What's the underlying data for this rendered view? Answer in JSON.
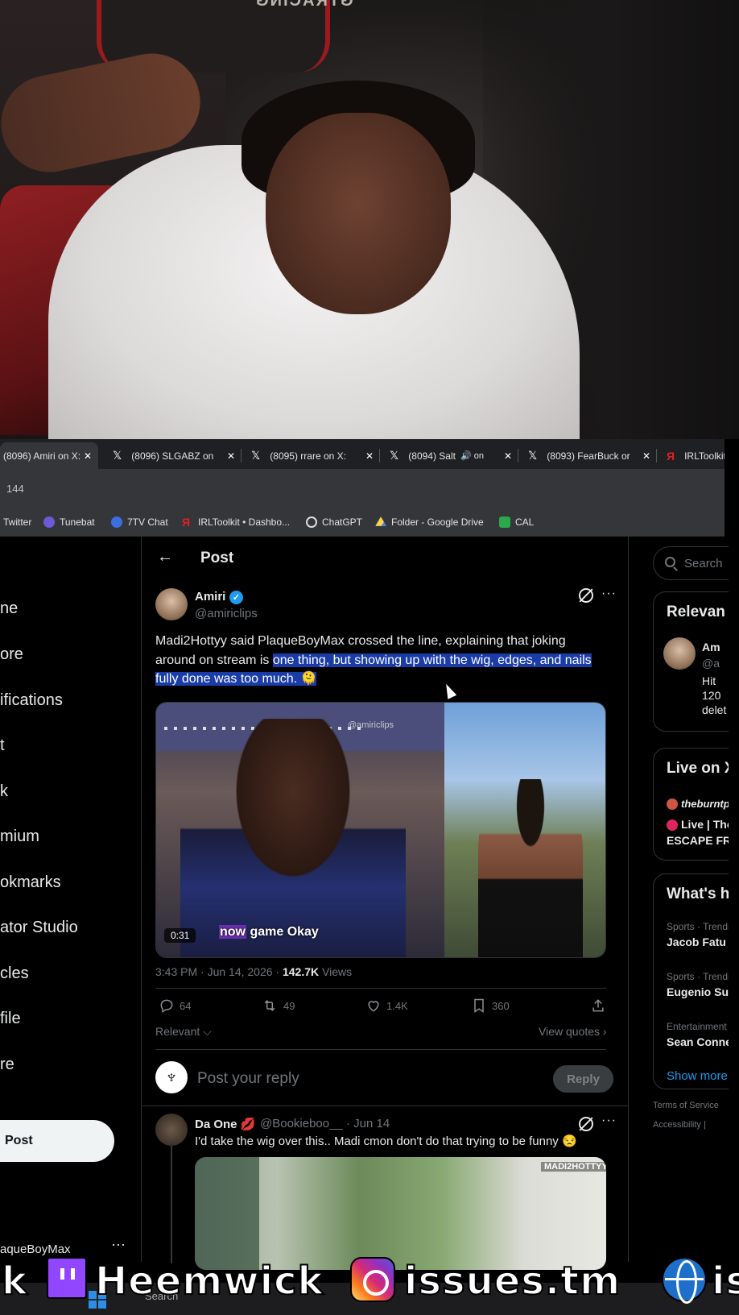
{
  "webcam": {
    "chair_brand": "GTRACING"
  },
  "tabs": [
    {
      "label": "(8096) Amiri on X:",
      "active": true
    },
    {
      "label": "(8096) SLGABZ on",
      "active": false
    },
    {
      "label": "(8095) rrare on X:",
      "active": false
    },
    {
      "label": "(8094) Salt",
      "active": false
    },
    {
      "label": "(8093) FearBuck or",
      "active": false
    },
    {
      "label": "IRLToolkit",
      "active": false
    }
  ],
  "address": {
    "url_fragment": "144"
  },
  "bookmarks": [
    {
      "label": "Twitter",
      "icon": "twitter-icon"
    },
    {
      "label": "Tunebat",
      "icon": "tunebat-icon"
    },
    {
      "label": "7TV Chat",
      "icon": "7tv-icon"
    },
    {
      "label": "IRLToolkit • Dashbo...",
      "icon": "irltoolkit-icon"
    },
    {
      "label": "ChatGPT",
      "icon": "chatgpt-icon"
    },
    {
      "label": "Folder - Google Drive",
      "icon": "drive-icon"
    },
    {
      "label": "CAL",
      "icon": "cal-icon"
    }
  ],
  "leftnav": {
    "items": [
      "ne",
      "ore",
      "ifications",
      "t",
      "k",
      "mium",
      "okmarks",
      "ator Studio",
      "cles",
      "file",
      "re"
    ],
    "post_button": "Post",
    "profile_handle": "aqueBoyMax",
    "more": "···"
  },
  "header": {
    "back": "←",
    "title": "Post"
  },
  "post": {
    "author_name": "Amiri",
    "verified": "✓",
    "author_handle": "@amiriclips",
    "text_plain": "Madi2Hottyy said PlaqueBoyMax crossed the line, explaining that joking around on stream is ",
    "text_highlighted": "one thing, but showing up with the wig, edges, and nails fully done was too much. 🫠",
    "media": {
      "watermark": "@amiriclips",
      "time": "0:31",
      "caption_highlight": "now",
      "caption_rest": " game Okay"
    },
    "time": "3:43 PM · Jun 14, 2026 · ",
    "views_count": "142.7K",
    "views_label": " Views",
    "actions": {
      "replies": "64",
      "reposts": "49",
      "likes": "1.4K",
      "bookmarks": "360"
    },
    "sort_label": "Relevant",
    "view_quotes": "View quotes"
  },
  "reply_box": {
    "placeholder": "Post your reply",
    "button": "Reply"
  },
  "comment": {
    "name": "Da One 💋",
    "handle": "@Bookieboo__ · Jun 14",
    "text": "I'd take the wig over this.. Madi cmon don't do that trying to be funny 😒",
    "media_watermark": "MADI2HOTTYY"
  },
  "right_sidebar": {
    "search_placeholder": "Search",
    "relevant_title": "Relevan",
    "relevant_user": "Am",
    "relevant_handle": "@a",
    "relevant_bio_1": "Hit",
    "relevant_bio_2": "120",
    "relevant_bio_3": "delet",
    "live_title": "Live on X",
    "live_host": "theburntpe",
    "live_line1": "Live | The",
    "live_line2": "ESCAPE FRO",
    "whats_title": "What's ha",
    "trends": [
      {
        "category": "Sports · Trendi",
        "name": "Jacob Fatu"
      },
      {
        "category": "Sports · Trendi",
        "name": "Eugenio Sua"
      },
      {
        "category": "Entertainment",
        "name": "Sean Conne"
      }
    ],
    "show_more": "Show more",
    "footer1": "Terms of Service",
    "footer2": "Accessibility  |"
  },
  "overlay": {
    "left_text": "k",
    "twitch_name": "Heemwick",
    "ig_name": "issues.tm",
    "right_text": "is"
  },
  "taskbar": {
    "search": "Search"
  }
}
